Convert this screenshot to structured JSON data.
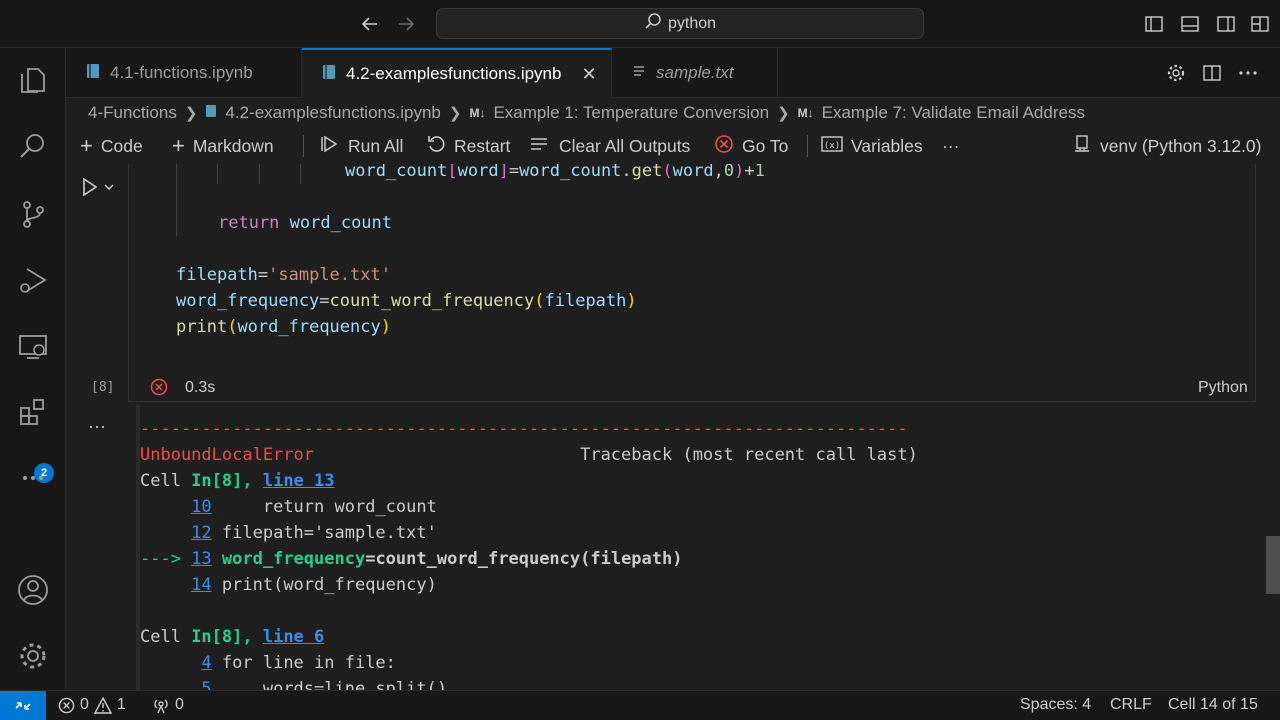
{
  "titlebar": {
    "search_text": "python"
  },
  "tabs": [
    {
      "label": "4.1-functions.ipynb"
    },
    {
      "label": "4.2-examplesfunctions.ipynb"
    },
    {
      "label": "sample.txt"
    }
  ],
  "breadcrumb": {
    "folder": "4-Functions",
    "file": "4.2-examplesfunctions.ipynb",
    "section1": "Example 1: Temperature Conversion",
    "section2": "Example 7: Validate Email Address"
  },
  "toolbar": {
    "code": "Code",
    "markdown": "Markdown",
    "run_all": "Run All",
    "restart": "Restart",
    "clear_outputs": "Clear All Outputs",
    "go_to": "Go To",
    "variables": "Variables",
    "more": "···",
    "kernel": "venv (Python 3.12.0)"
  },
  "cell": {
    "execution_count": "[8]",
    "exec_time": "0.3s",
    "language": "Python"
  },
  "code_lines": {
    "l1_a": "word_count",
    "l1_b": "[",
    "l1_c": "word",
    "l1_d": "]",
    "l1_e": "=",
    "l1_f": "word_count",
    "l1_g": ".",
    "l1_h": "get",
    "l1_i": "(",
    "l1_j": "word",
    "l1_k": ",",
    "l1_l": "0",
    "l1_m": ")",
    "l1_n": "+",
    "l1_o": "1",
    "l2_kw": "return",
    "l2_var": " word_count",
    "l3_var": "filepath",
    "l3_eq": "=",
    "l3_str": "'sample.txt'",
    "l4_var": "word_frequency",
    "l4_eq": "=",
    "l4_fn": "count_word_frequency",
    "l4_open": "(",
    "l4_arg": "filepath",
    "l4_close": ")",
    "l5_fn": "print",
    "l5_open": "(",
    "l5_arg": "word_frequency",
    "l5_close": ")"
  },
  "output": {
    "dashes": "---------------------------------------------------------------------------",
    "error_name": "UnboundLocalError",
    "traceback_header": "                          Traceback (most recent call last)",
    "cell1_prefix": "Cell ",
    "cell1_in": "In[8], ",
    "cell1_line": "line 13",
    "tb1_n10": "10",
    "tb1_t10": "     return word_count",
    "tb1_n12": "12",
    "tb1_t12": " filepath='sample.txt'",
    "tb1_arrow": "---> ",
    "tb1_n13": "13",
    "tb1_t13a": " word_frequency",
    "tb1_t13b": "=count_word_frequency(filepath)",
    "tb1_n14": "14",
    "tb1_t14": " print(word_frequency)",
    "cell2_prefix": "Cell ",
    "cell2_in": "In[8], ",
    "cell2_line": "line 6",
    "tb2_n4": "4",
    "tb2_t4": " for line in file:",
    "tb2_n5": "5",
    "tb2_t5": "     words=line.split()"
  },
  "statusbar": {
    "errors": "0",
    "warnings": "1",
    "ports": "0",
    "spaces": "Spaces: 4",
    "eol": "CRLF",
    "cell_pos": "Cell 14 of 15"
  },
  "activity": {
    "extensions_badge": "2"
  },
  "colors": {
    "accent": "#0078d4",
    "error": "#f14c4c",
    "green": "#23d18b",
    "link": "#3b8eea"
  }
}
